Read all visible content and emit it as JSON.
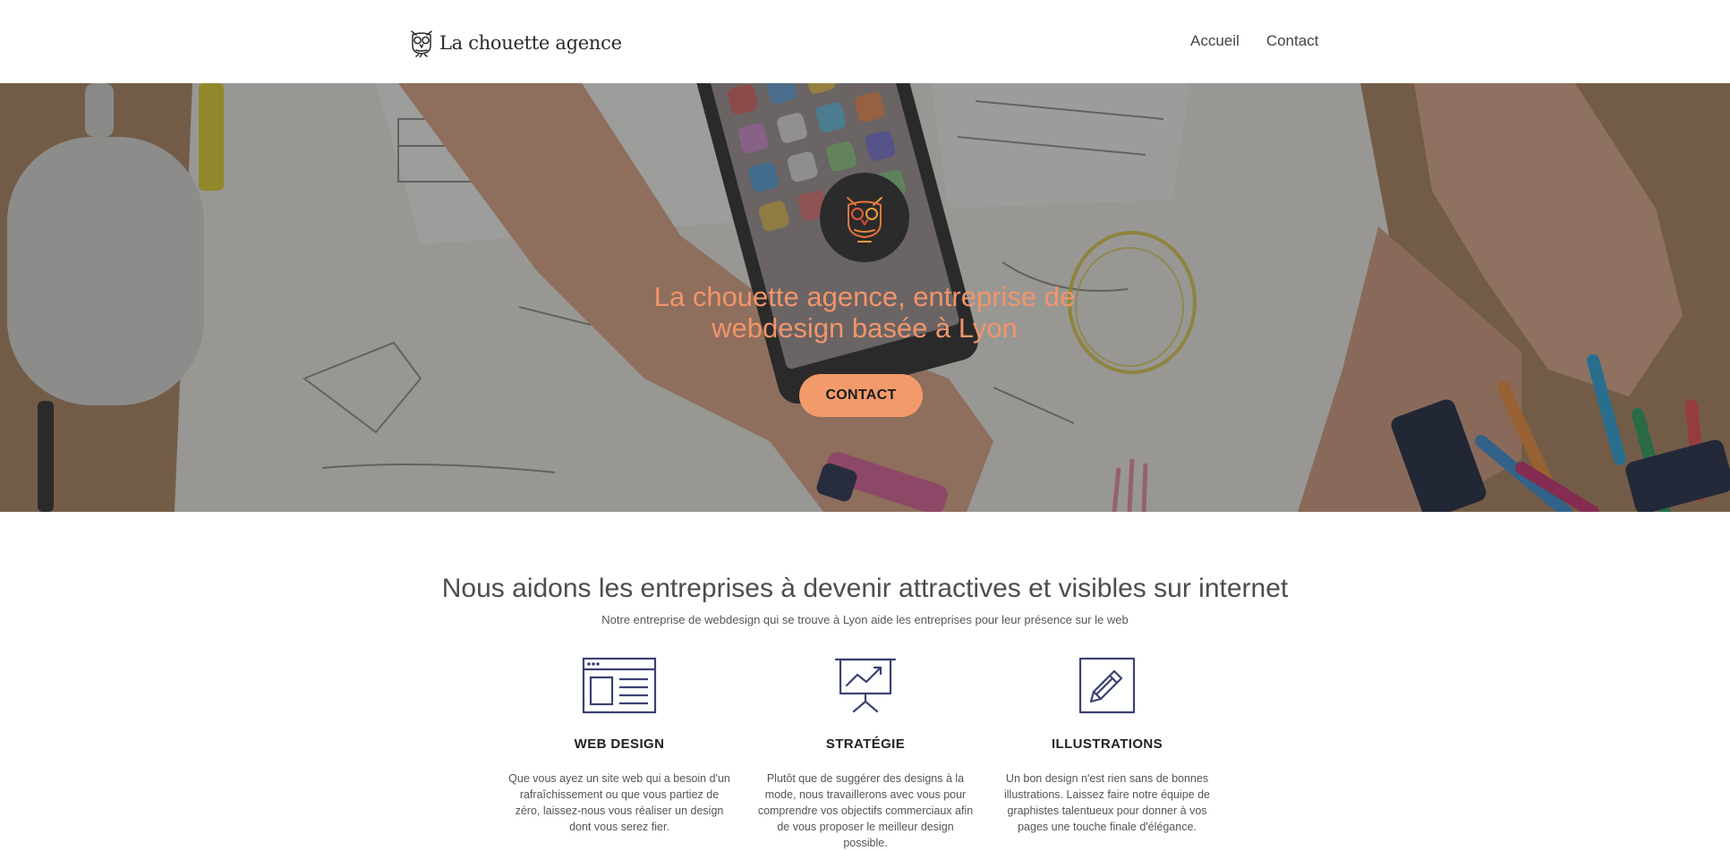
{
  "header": {
    "brand": "La chouette agence",
    "nav": [
      {
        "label": "Accueil"
      },
      {
        "label": "Contact"
      }
    ]
  },
  "hero": {
    "title_line1": "La chouette agence, entreprise de",
    "title_line2": "webdesign basée à Lyon",
    "cta_label": "CONTACT",
    "accent_color": "#f39a6b"
  },
  "intro": {
    "title": "Nous aidons les entreprises à devenir attractives et visibles sur internet",
    "subtitle": "Notre entreprise de webdesign qui se trouve à Lyon aide les entreprises pour leur présence sur le web"
  },
  "services": [
    {
      "icon": "browser-window-icon",
      "title": "WEB DESIGN",
      "text": "Que vous ayez un site web qui a besoin d'un rafraîchissement ou que vous partiez de zéro, laissez-nous vous réaliser un design dont vous serez fier."
    },
    {
      "icon": "presentation-chart-icon",
      "title": "STRATÉGIE",
      "text": "Plutôt que de suggérer des designs à la mode, nous travaillerons avec vous pour comprendre vos objectifs commerciaux afin de vous proposer le meilleur design possible."
    },
    {
      "icon": "pencil-edit-icon",
      "title": "ILLUSTRATIONS",
      "text": "Un bon design n'est rien sans de bonnes illustrations. Laissez faire notre équipe de graphistes talentueux pour donner à vos pages une touche finale d'élégance."
    }
  ],
  "colors": {
    "icon_stroke": "#3b4173",
    "hero_title": "#f2956a"
  }
}
